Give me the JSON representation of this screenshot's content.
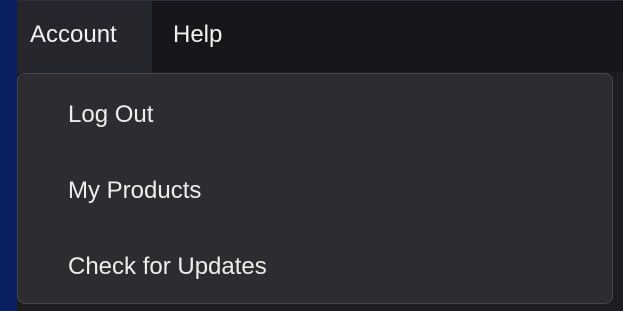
{
  "menubar": {
    "items": [
      {
        "label": "Account",
        "active": true
      },
      {
        "label": "Help",
        "active": false
      }
    ]
  },
  "account_menu": {
    "items": [
      {
        "label": "Log Out"
      },
      {
        "label": "My Products"
      },
      {
        "label": "Check for Updates"
      }
    ]
  },
  "colors": {
    "desktop_background": "#0b2060",
    "menubar_background": "#17171b",
    "active_menu_background": "#26272c",
    "dropdown_background": "#2d2d31",
    "dropdown_border": "#45464c",
    "text": "#f2f2f2"
  }
}
